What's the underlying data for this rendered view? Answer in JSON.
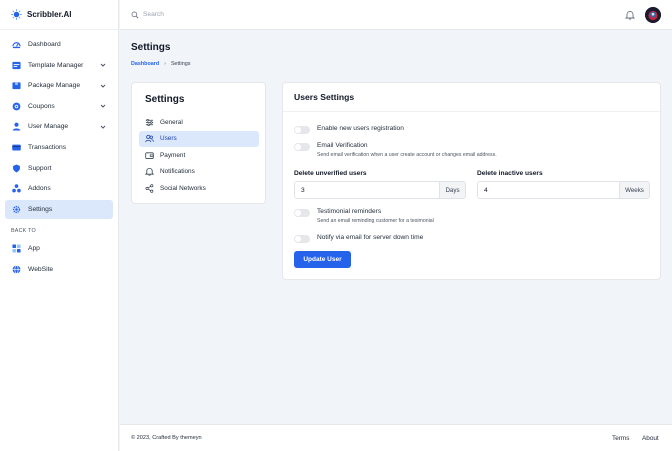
{
  "brand": {
    "name": "Scribbler.AI"
  },
  "sidebar": {
    "items": [
      {
        "label": "Dashboard",
        "icon": "dashboard-icon"
      },
      {
        "label": "Template Manager",
        "icon": "template-icon",
        "has_submenu": true
      },
      {
        "label": "Package Manage",
        "icon": "package-icon",
        "has_submenu": true
      },
      {
        "label": "Coupons",
        "icon": "coupon-icon",
        "has_submenu": true
      },
      {
        "label": "User Manage",
        "icon": "user-icon",
        "has_submenu": true
      },
      {
        "label": "Transactions",
        "icon": "card-icon"
      },
      {
        "label": "Support",
        "icon": "support-icon"
      },
      {
        "label": "Addons",
        "icon": "addons-icon"
      },
      {
        "label": "Settings",
        "icon": "gear-icon",
        "active": true
      }
    ],
    "back_to_label": "BACK TO",
    "back_items": [
      {
        "label": "App",
        "icon": "grid-icon"
      },
      {
        "label": "WebSite",
        "icon": "globe-icon"
      }
    ]
  },
  "topbar": {
    "search_placeholder": "Search"
  },
  "page": {
    "title": "Settings",
    "breadcrumb": {
      "home": "Dashboard",
      "separator": "›",
      "current": "Settings"
    }
  },
  "settings_menu": {
    "title": "Settings",
    "items": [
      {
        "label": "General",
        "icon": "sliders-icon"
      },
      {
        "label": "Users",
        "icon": "users-icon",
        "active": true
      },
      {
        "label": "Payment",
        "icon": "wallet-icon"
      },
      {
        "label": "Notifications",
        "icon": "bell-icon"
      },
      {
        "label": "Social Networks",
        "icon": "share-icon"
      }
    ]
  },
  "users_settings": {
    "title": "Users Settings",
    "enable_registration": {
      "label": "Enable new users registration",
      "on": false
    },
    "email_verification": {
      "label": "Email Verification",
      "help": "Send email verification when a user create account or changes email address.",
      "on": false
    },
    "delete_unverified": {
      "label": "Delete unverified users",
      "value": "3",
      "unit": "Days"
    },
    "delete_inactive": {
      "label": "Delete inactive users",
      "value": "4",
      "unit": "Weeks"
    },
    "testimonial": {
      "label": "Testimonial reminders",
      "help": "Send an email reminding customer for a tesimonial",
      "on": false
    },
    "notify_down": {
      "label": "Notify via email for server down time",
      "on": false
    },
    "submit_label": "Update User"
  },
  "footer": {
    "copyright": "© 2023, Crafted By themeyn",
    "links": [
      "Terms",
      "About"
    ]
  },
  "colors": {
    "accent": "#2563eb",
    "active_bg": "#dbe8fb",
    "page_bg": "#f1f4f9"
  }
}
